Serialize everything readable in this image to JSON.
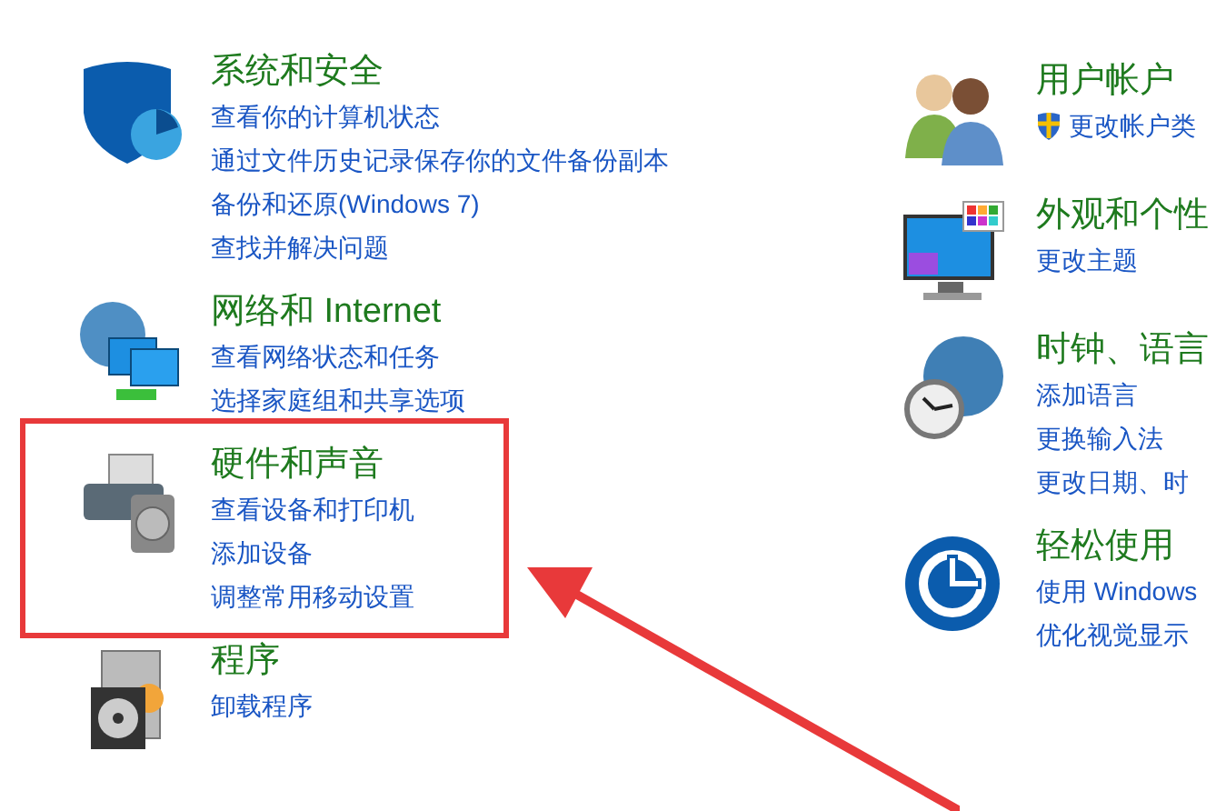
{
  "columns": [
    {
      "sections": [
        {
          "kind": "security",
          "title": "系统和安全",
          "links": [
            {
              "text": "查看你的计算机状态"
            },
            {
              "text": "通过文件历史记录保存你的文件备份副本"
            },
            {
              "text": "备份和还原(Windows 7)"
            },
            {
              "text": "查找并解决问题"
            }
          ]
        },
        {
          "kind": "network",
          "title": "网络和 Internet",
          "links": [
            {
              "text": "查看网络状态和任务"
            },
            {
              "text": "选择家庭组和共享选项"
            }
          ]
        },
        {
          "kind": "hardware",
          "title": "硬件和声音",
          "links": [
            {
              "text": "查看设备和打印机"
            },
            {
              "text": "添加设备"
            },
            {
              "text": "调整常用移动设置"
            }
          ]
        },
        {
          "kind": "programs",
          "title": "程序",
          "links": [
            {
              "text": "卸载程序"
            }
          ]
        }
      ]
    },
    {
      "sections": [
        {
          "kind": "users",
          "title": "用户帐户",
          "links": [
            {
              "text": "更改帐户类",
              "shield": true
            }
          ]
        },
        {
          "kind": "appearance",
          "title": "外观和个性",
          "links": [
            {
              "text": "更改主题"
            }
          ]
        },
        {
          "kind": "clock",
          "title": "时钟、语言",
          "links": [
            {
              "text": "添加语言"
            },
            {
              "text": "更换输入法"
            },
            {
              "text": "更改日期、时"
            }
          ]
        },
        {
          "kind": "ease",
          "title": "轻松使用",
          "links": [
            {
              "text": "使用 Windows"
            },
            {
              "text": "优化视觉显示"
            }
          ]
        }
      ]
    }
  ]
}
